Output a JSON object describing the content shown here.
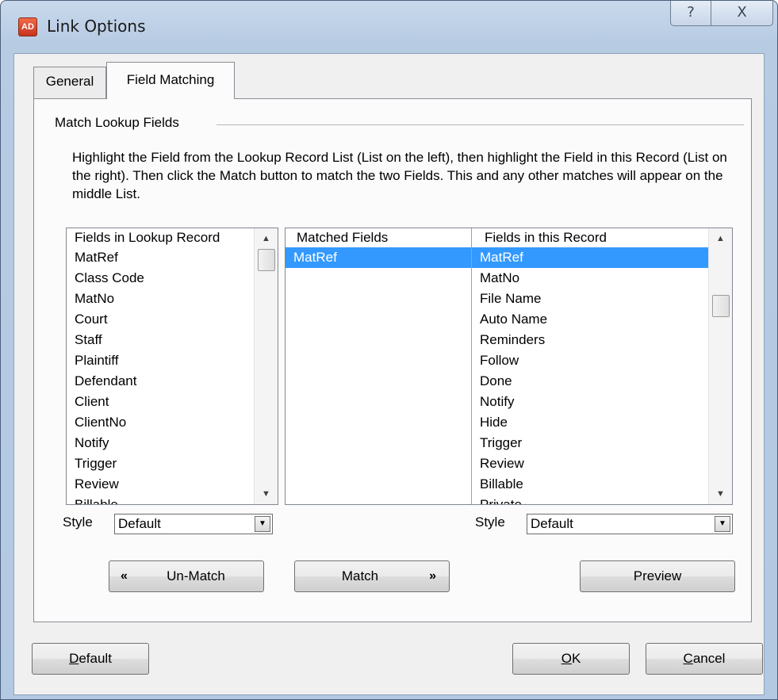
{
  "window": {
    "title": "Link Options",
    "app_icon_text": "AD",
    "help_label": "?",
    "close_label": "X"
  },
  "tabs": [
    {
      "label": "General",
      "selected": false
    },
    {
      "label": "Field Matching",
      "selected": true
    }
  ],
  "group_label": "Match Lookup Fields",
  "instructions": "Highlight the Field from the Lookup Record List (List on the left), then highlight the Field in this Record (List on the right). Then click the Match button to match the two Fields. This and any other matches will appear on the middle List.",
  "left_list": {
    "header": "Fields in Lookup Record",
    "items": [
      "MatRef",
      "Class Code",
      "MatNo",
      "Court",
      "Staff",
      "Plaintiff",
      "Defendant",
      "Client",
      "ClientNo",
      "Notify",
      "Trigger",
      "Review",
      "Billable"
    ]
  },
  "mid_list": {
    "matched_header": "Matched Fields",
    "record_header": "Fields in this Record",
    "matched_items": [
      "MatRef"
    ],
    "record_items": [
      "MatRef",
      "MatNo",
      "File Name",
      "Auto Name",
      "Reminders",
      "Follow",
      "Done",
      "Notify",
      "Hide",
      "Trigger",
      "Review",
      "Billable",
      "Private"
    ]
  },
  "style_left": {
    "label": "Style",
    "value": "Default"
  },
  "style_right": {
    "label": "Style",
    "value": "Default"
  },
  "buttons": {
    "unmatch": "Un-Match",
    "match": "Match",
    "preview": "Preview",
    "default_mnemonic": "D",
    "default_rest": "efault",
    "ok_mnemonic": "O",
    "ok_rest": "K",
    "cancel_mnemonic": "C",
    "cancel_rest": "ancel"
  },
  "glyphs": {
    "left_chevrons": "«",
    "right_chevrons": "»",
    "arrow_up": "▲",
    "arrow_down": "▼"
  },
  "colors": {
    "selection": "#3399ff",
    "window_frame": "#b7cbe3"
  }
}
